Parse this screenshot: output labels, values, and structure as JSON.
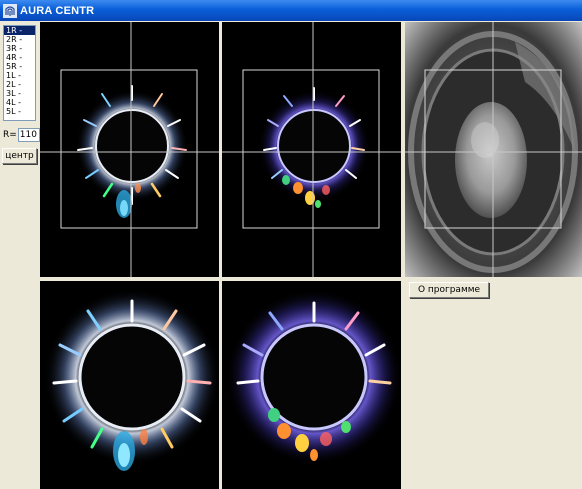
{
  "window": {
    "title": "AURA CENTR"
  },
  "sidebar": {
    "items": [
      {
        "label": "1R -",
        "selected": true
      },
      {
        "label": "2R -",
        "selected": false
      },
      {
        "label": "3R -",
        "selected": false
      },
      {
        "label": "4R -",
        "selected": false
      },
      {
        "label": "5R -",
        "selected": false
      },
      {
        "label": "1L -",
        "selected": false
      },
      {
        "label": "2L -",
        "selected": false
      },
      {
        "label": "3L -",
        "selected": false
      },
      {
        "label": "4L -",
        "selected": false
      },
      {
        "label": "5L -",
        "selected": false
      }
    ],
    "r_label": "R=",
    "r_value": "110",
    "center_button": "центр"
  },
  "about_button": "О программе",
  "colors": {
    "titlebar": "#0a5fd8",
    "window_bg": "#ece9d8",
    "crosshair": "#c8c8c8",
    "frame": "#d8d8d8",
    "selection": "#0a246a"
  },
  "icons": {
    "app": "fingerprint-app-icon"
  }
}
